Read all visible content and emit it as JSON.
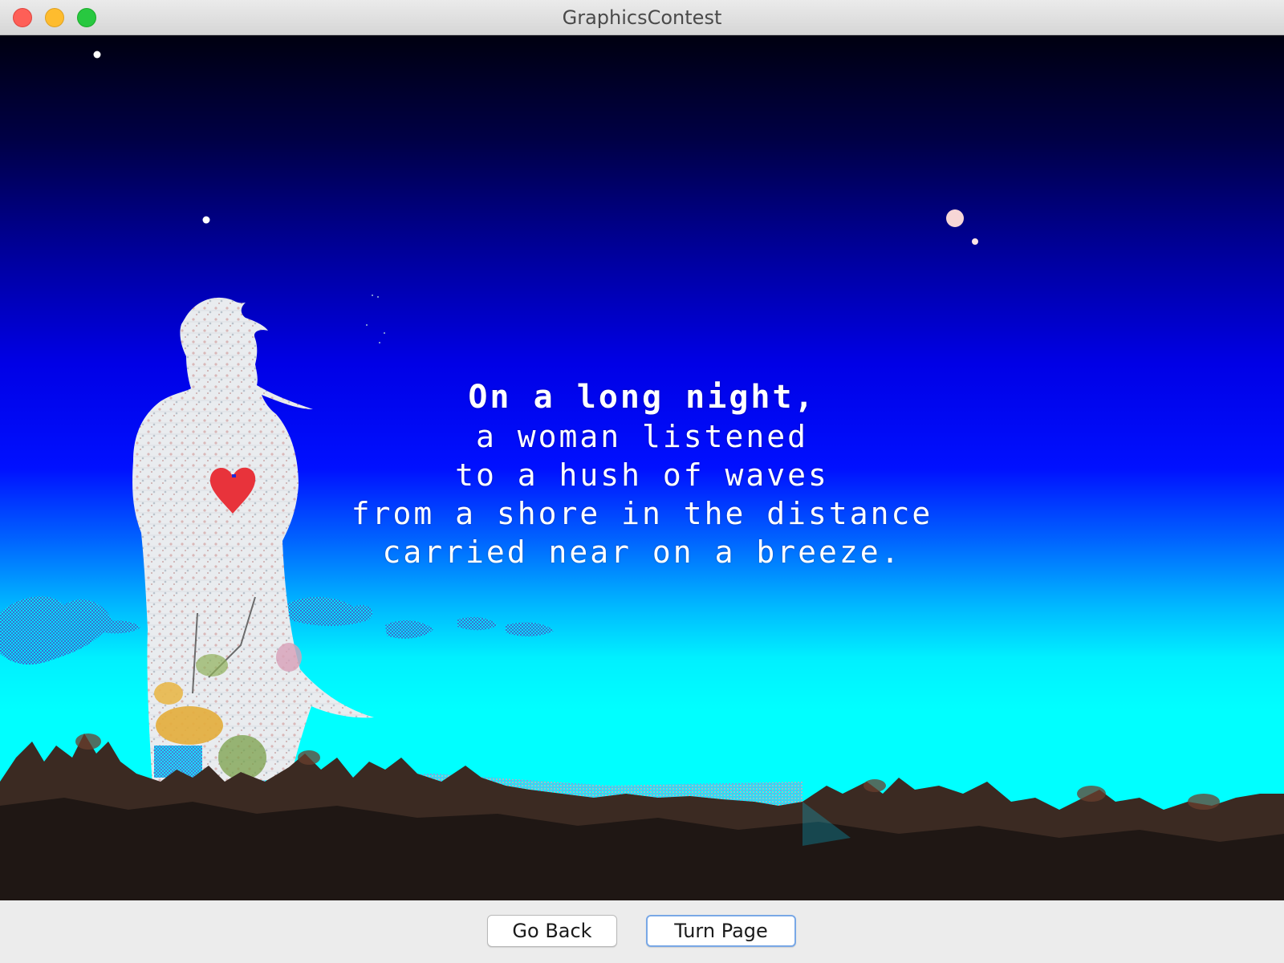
{
  "window": {
    "title": "GraphicsContest"
  },
  "poem": {
    "lines": [
      "On a long night,",
      "a woman listened",
      "to a hush of waves",
      "from a shore in the distance",
      "carried near on a breeze."
    ]
  },
  "buttons": {
    "back_label": "Go Back",
    "next_label": "Turn Page"
  },
  "colors": {
    "sky_top": "#000010",
    "sky_mid": "#0000e6",
    "sky_horizon": "#00ffff",
    "heart": "#e8333b",
    "text": "#ffffff",
    "focus_ring": "#79a8e6"
  },
  "icons": [
    "close-icon",
    "minimize-icon",
    "maximize-icon",
    "star-icon",
    "moon-icon",
    "heart-icon"
  ]
}
